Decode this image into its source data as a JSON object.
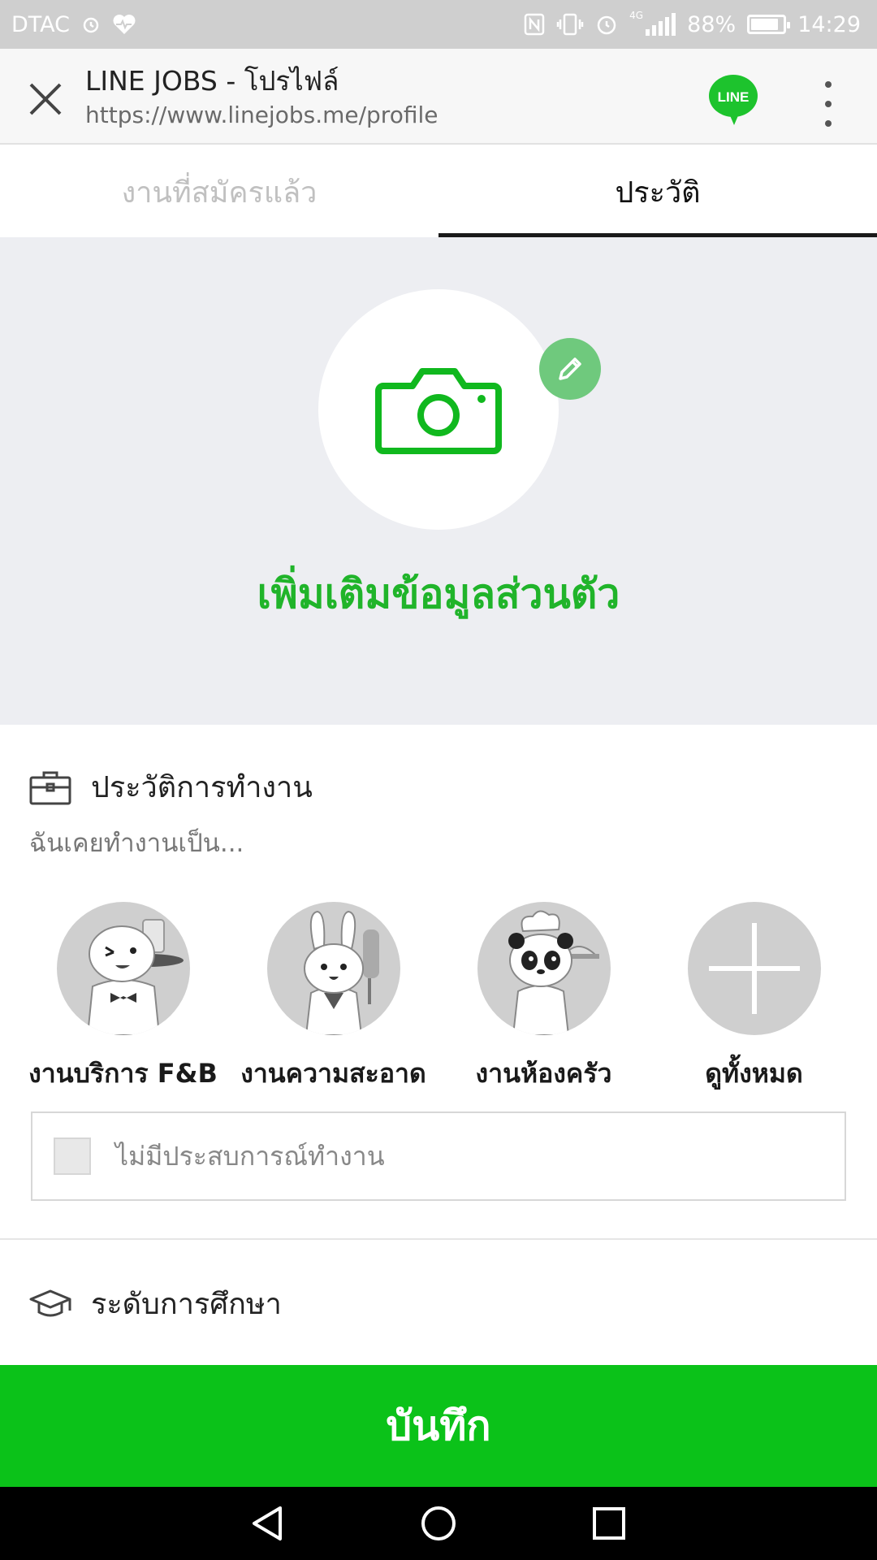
{
  "status_bar": {
    "carrier": "DTAC",
    "battery": "88%",
    "battery_level": 0.88,
    "time": "14:29",
    "network": "4G"
  },
  "browser": {
    "title": "LINE JOBS - โปรไฟล์",
    "url": "https://www.linejobs.me/profile",
    "logo_text": "LINE",
    "accent_color": "#0bc219"
  },
  "tabs": [
    {
      "label": "งานที่สมัครแล้ว",
      "active": false
    },
    {
      "label": "ประวัติ",
      "active": true
    }
  ],
  "profile": {
    "add_info_label": "เพิ่มเติมข้อมูลส่วนตัว"
  },
  "work_history": {
    "heading": "ประวัติการทำงาน",
    "subtitle": "ฉันเคยทำงานเป็น...",
    "categories": [
      {
        "label": "งานบริการ F&B",
        "icon": "waiter-character-icon"
      },
      {
        "label": "งานความสะอาด",
        "icon": "cleaner-character-icon"
      },
      {
        "label": "งานห้องครัว",
        "icon": "chef-character-icon"
      },
      {
        "label": "ดูทั้งหมด",
        "icon": "plus-icon"
      }
    ],
    "no_experience_label": "ไม่มีประสบการณ์ทำงาน"
  },
  "education": {
    "heading": "ระดับการศึกษา"
  },
  "save_button": {
    "label": "บันทึก"
  }
}
